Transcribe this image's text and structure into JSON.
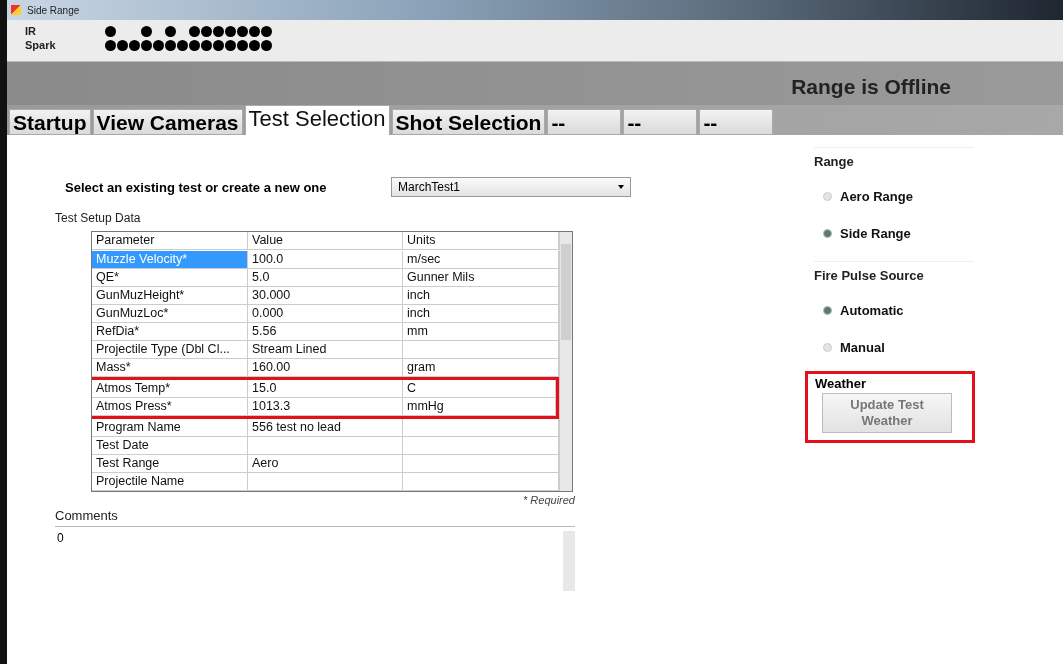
{
  "window": {
    "title": "Side Range"
  },
  "indicators": [
    {
      "label": "IR",
      "dots": [
        {
          "on": true
        },
        {
          "on": false
        },
        {
          "on": false
        },
        {
          "on": true
        },
        {
          "on": false
        },
        {
          "on": true
        },
        {
          "on": false
        },
        {
          "on": true
        },
        {
          "on": true
        },
        {
          "on": true
        },
        {
          "on": true
        },
        {
          "on": true
        },
        {
          "on": true
        },
        {
          "on": true
        }
      ]
    },
    {
      "label": "Spark",
      "dots": [
        {
          "on": true
        },
        {
          "on": true
        },
        {
          "on": true
        },
        {
          "on": true
        },
        {
          "on": true
        },
        {
          "on": true
        },
        {
          "on": true
        },
        {
          "on": true
        },
        {
          "on": true
        },
        {
          "on": true
        },
        {
          "on": true
        },
        {
          "on": true
        },
        {
          "on": true
        },
        {
          "on": true
        }
      ]
    }
  ],
  "status": "Range is Offline",
  "tabs": [
    {
      "label": "Startup",
      "selected": false
    },
    {
      "label": "View Cameras",
      "selected": false
    },
    {
      "label": "Test Selection",
      "selected": true
    },
    {
      "label": "Shot Selection",
      "selected": false
    },
    {
      "label": "--",
      "selected": false
    },
    {
      "label": "--",
      "selected": false
    },
    {
      "label": "--",
      "selected": false
    }
  ],
  "test_select": {
    "label": "Select an existing test or create a new one",
    "value": "MarchTest1"
  },
  "setup": {
    "title": "Test Setup Data",
    "columns": [
      "Parameter",
      "Value",
      "Units"
    ],
    "rows": [
      {
        "cells": [
          "Muzzle Velocity*",
          "100.0",
          "m/sec"
        ],
        "selected": true,
        "highlighted": false
      },
      {
        "cells": [
          "QE*",
          "5.0",
          "Gunner Mils"
        ],
        "selected": false,
        "highlighted": false
      },
      {
        "cells": [
          "GunMuzHeight*",
          "30.000",
          "inch"
        ],
        "selected": false,
        "highlighted": false
      },
      {
        "cells": [
          "GunMuzLoc*",
          "0.000",
          "inch"
        ],
        "selected": false,
        "highlighted": false
      },
      {
        "cells": [
          "RefDia*",
          "5.56",
          "mm"
        ],
        "selected": false,
        "highlighted": false
      },
      {
        "cells": [
          "Projectile Type (Dbl Cl...",
          "Stream Lined",
          ""
        ],
        "selected": false,
        "highlighted": false
      },
      {
        "cells": [
          "Mass*",
          "160.00",
          "gram"
        ],
        "selected": false,
        "highlighted": false
      },
      {
        "cells": [
          "Atmos Temp*",
          "15.0",
          "C"
        ],
        "selected": false,
        "highlighted": true
      },
      {
        "cells": [
          "Atmos Press*",
          "1013.3",
          "mmHg"
        ],
        "selected": false,
        "highlighted": true
      },
      {
        "cells": [
          "Program Name",
          "556 test no lead",
          ""
        ],
        "selected": false,
        "highlighted": false
      },
      {
        "cells": [
          "Test Date",
          "",
          ""
        ],
        "selected": false,
        "highlighted": false
      },
      {
        "cells": [
          "Test Range",
          "Aero",
          ""
        ],
        "selected": false,
        "highlighted": false
      },
      {
        "cells": [
          "Projectile Name",
          "",
          ""
        ],
        "selected": false,
        "highlighted": false
      }
    ],
    "note": "* Required"
  },
  "comments": {
    "label": "Comments",
    "value": "0"
  },
  "range": {
    "title": "Range",
    "options": [
      {
        "label": "Aero Range",
        "selected": false
      },
      {
        "label": "Side Range",
        "selected": true
      }
    ]
  },
  "fire_pulse": {
    "title": "Fire Pulse Source",
    "options": [
      {
        "label": "Automatic",
        "selected": true
      },
      {
        "label": "Manual",
        "selected": false
      }
    ]
  },
  "weather": {
    "title": "Weather",
    "button": "Update Test Weather",
    "highlighted": true
  }
}
